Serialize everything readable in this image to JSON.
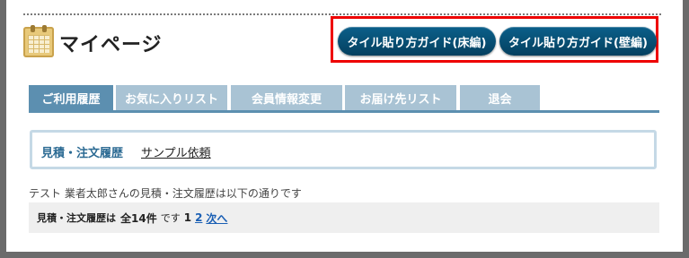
{
  "page": {
    "title": "マイページ",
    "title_icon": "calendar-icon"
  },
  "guide_buttons": {
    "floor": "タイル貼り方ガイド(床編)",
    "wall": "タイル貼り方ガイド(壁編)",
    "highlight_color": "#ee0000"
  },
  "tabs": [
    {
      "label": "ご利用履歴",
      "active": true
    },
    {
      "label": "お気に入りリスト",
      "active": false
    },
    {
      "label": "会員情報変更",
      "active": false
    },
    {
      "label": "お届け先リスト",
      "active": false
    },
    {
      "label": "退会",
      "active": false
    }
  ],
  "subnav": {
    "active": "見積・注文履歴",
    "link": "サンプル依頼"
  },
  "info": "テスト 業者太郎さんの見積・注文履歴は以下の通りです",
  "history": {
    "label": "見積・注文履歴は",
    "count": "全14件",
    "desu": "です",
    "current_page": "1",
    "page2": "2",
    "next": "次へ"
  },
  "colors": {
    "accent": "#5c8fb0",
    "tab_inactive": "#a9c3d4",
    "button": "#04405f"
  }
}
